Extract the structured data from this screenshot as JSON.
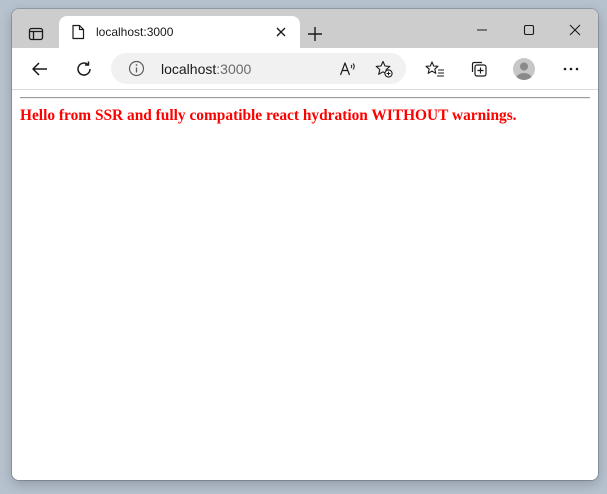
{
  "browser": {
    "tab": {
      "title": "localhost:3000",
      "icon": "page-icon"
    },
    "address_bar": {
      "host": "localhost",
      "port": ":3000",
      "info_icon": "info-icon"
    },
    "icons": {
      "tab_actions": "tab-actions-icon",
      "close_tab": "close-icon",
      "new_tab": "plus-icon",
      "minimize": "minimize-icon",
      "maximize": "maximize-icon",
      "close_window": "close-icon",
      "back": "back-arrow-icon",
      "refresh": "refresh-icon",
      "read_aloud": "read-aloud-icon",
      "add_favorite": "star-add-icon",
      "favorites": "favorites-icon",
      "collections": "collections-icon",
      "profile": "profile-icon",
      "more": "more-icon"
    }
  },
  "page": {
    "heading": "Hello from SSR and fully compatible react hydration WITHOUT warnings.",
    "heading_color": "#ff0000"
  },
  "colors": {
    "titlebar": "#cdcdcd",
    "toolbar": "#ffffff",
    "address_bar": "#f1f1f1"
  }
}
